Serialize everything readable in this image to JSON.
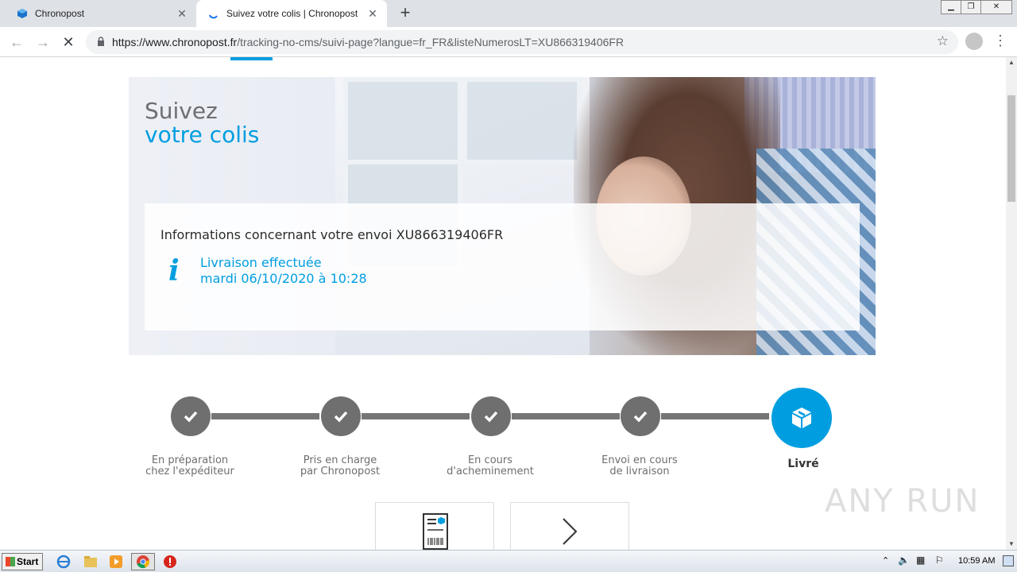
{
  "browser": {
    "tabs": [
      {
        "title": "Chronopost",
        "active": false
      },
      {
        "title": "Suivez  votre colis | Chronopost",
        "active": true
      }
    ],
    "url_domain": "https://www.chronopost.fr",
    "url_path": "/tracking-no-cms/suivi-page?langue=fr_FR&listeNumerosLT=XU866319406FR"
  },
  "hero": {
    "title_line1": "Suivez",
    "title_line2": "votre colis",
    "info_title": "Informations concernant votre envoi XU866319406FR",
    "status_line1": "Livraison effectuée",
    "status_line2": "mardi 06/10/2020 à 10:28"
  },
  "steps": [
    {
      "label_line1": "En préparation",
      "label_line2": "chez l'expéditeur",
      "done": true
    },
    {
      "label_line1": "Pris en charge",
      "label_line2": "par Chronopost",
      "done": true
    },
    {
      "label_line1": "En cours",
      "label_line2": "d'acheminement",
      "done": true
    },
    {
      "label_line1": "Envoi en cours",
      "label_line2": "de livraison",
      "done": true
    },
    {
      "label_line1": "Livré",
      "label_line2": "",
      "done": true,
      "current": true
    }
  ],
  "watermark": "ANY RUN",
  "taskbar": {
    "start_label": "Start",
    "clock": "10:59 AM"
  },
  "colors": {
    "brand_blue": "#009ee0",
    "step_grey": "#6f6f6f"
  }
}
